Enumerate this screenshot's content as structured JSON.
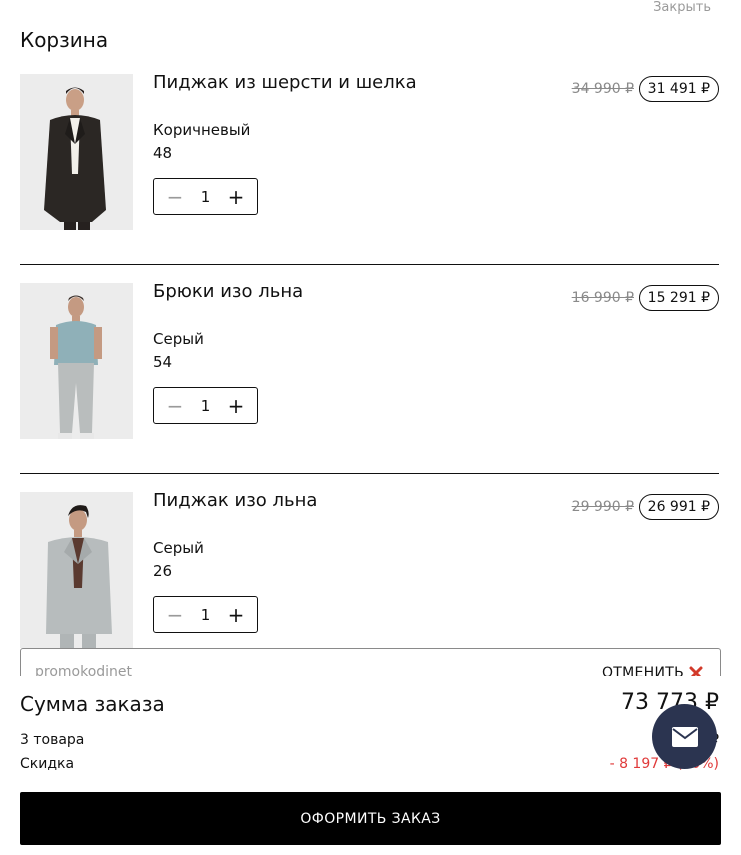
{
  "header": {
    "close_label": "Закрыть",
    "title": "Корзина"
  },
  "items": [
    {
      "name": "Пиджак из шерсти и шелка",
      "color": "Коричневый",
      "size": "48",
      "quantity": "1",
      "old_price": "34 990 ₽",
      "price": "31 491 ₽",
      "image": "model in brown wool-silk blazer"
    },
    {
      "name": "Брюки изо льна",
      "color": "Серый",
      "size": "54",
      "quantity": "1",
      "old_price": "16 990 ₽",
      "price": "15 291 ₽",
      "image": "model in grey linen trousers"
    },
    {
      "name": "Пиджак изо льна",
      "color": "Серый",
      "size": "26",
      "quantity": "1",
      "old_price": "29 990 ₽",
      "price": "26 991 ₽",
      "image": "model in grey linen blazer"
    }
  ],
  "stepper": {
    "minus": "−",
    "plus": "+"
  },
  "promo": {
    "value": "promokodinet",
    "cancel_label": "ОТМЕНИТЬ"
  },
  "summary": {
    "label": "Сумма заказа",
    "total": "73 773 ₽",
    "count_label": "3 товара",
    "count_value": "₽",
    "discount_label": "Скидка",
    "discount_value": "- 8 197 ₽ (10%)"
  },
  "checkout_label": "ОФОРМИТЬ ЗАКАЗ",
  "colors": {
    "accent": "#000000",
    "discount": "#e03a3a",
    "fab": "#2b3450",
    "muted": "#9a9a9a"
  }
}
